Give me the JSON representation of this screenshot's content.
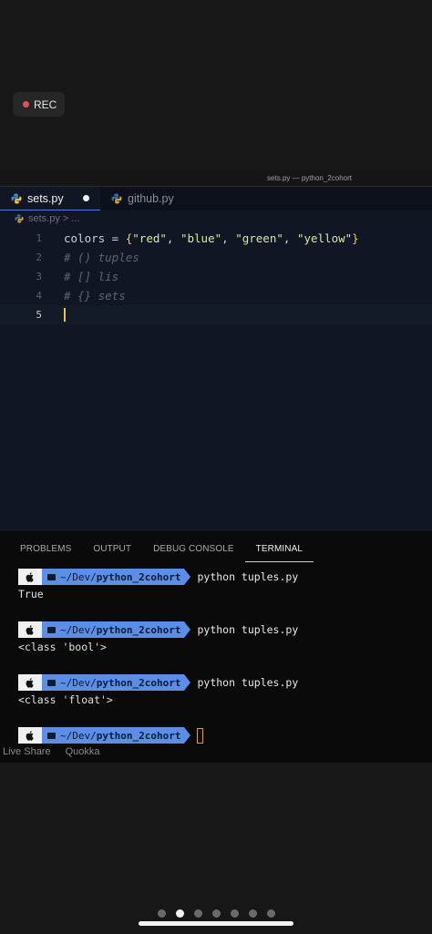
{
  "recorder": {
    "label": "REC"
  },
  "window": {
    "title": "sets.py — python_2cohort"
  },
  "tabs": [
    {
      "label": "sets.py",
      "active": true,
      "dirty": true
    },
    {
      "label": "github.py",
      "active": false
    }
  ],
  "breadcrumb": {
    "file": "sets.py",
    "separator": ">",
    "rest": "..."
  },
  "editor": {
    "lines": [
      {
        "number": "1",
        "var": "colors",
        "op": " = ",
        "open": "{",
        "s1": "\"red\"",
        "c1": ", ",
        "s2": "\"blue\"",
        "c2": ", ",
        "s3": "\"green\"",
        "c3": ", ",
        "s4": "\"yellow\"",
        "close": "}"
      },
      {
        "number": "2",
        "comment": "# () tuples"
      },
      {
        "number": "3",
        "comment": "# [] lis"
      },
      {
        "number": "4",
        "comment": "# {} sets"
      },
      {
        "number": "5"
      }
    ]
  },
  "panel": {
    "tabs": [
      "PROBLEMS",
      "OUTPUT",
      "DEBUG CONSOLE",
      "TERMINAL"
    ],
    "active_tab": "TERMINAL"
  },
  "terminal": {
    "path_prefix": "~/Dev/",
    "path_dir": "python_2cohort",
    "entries": [
      {
        "command": "python tuples.py",
        "output": "True"
      },
      {
        "command": "python tuples.py",
        "output": "<class 'bool'>"
      },
      {
        "command": "python tuples.py",
        "output": "<class 'float'>"
      }
    ]
  },
  "statusbar": {
    "live_share": "Live Share",
    "quokka": "Quokka"
  },
  "colors": {
    "accent": "#5b8ee6",
    "cursor": "#f0c040",
    "rec_dot": "#e05353"
  },
  "icons": [
    "python-icon",
    "apple-icon",
    "folder-icon",
    "record-dot-icon"
  ]
}
